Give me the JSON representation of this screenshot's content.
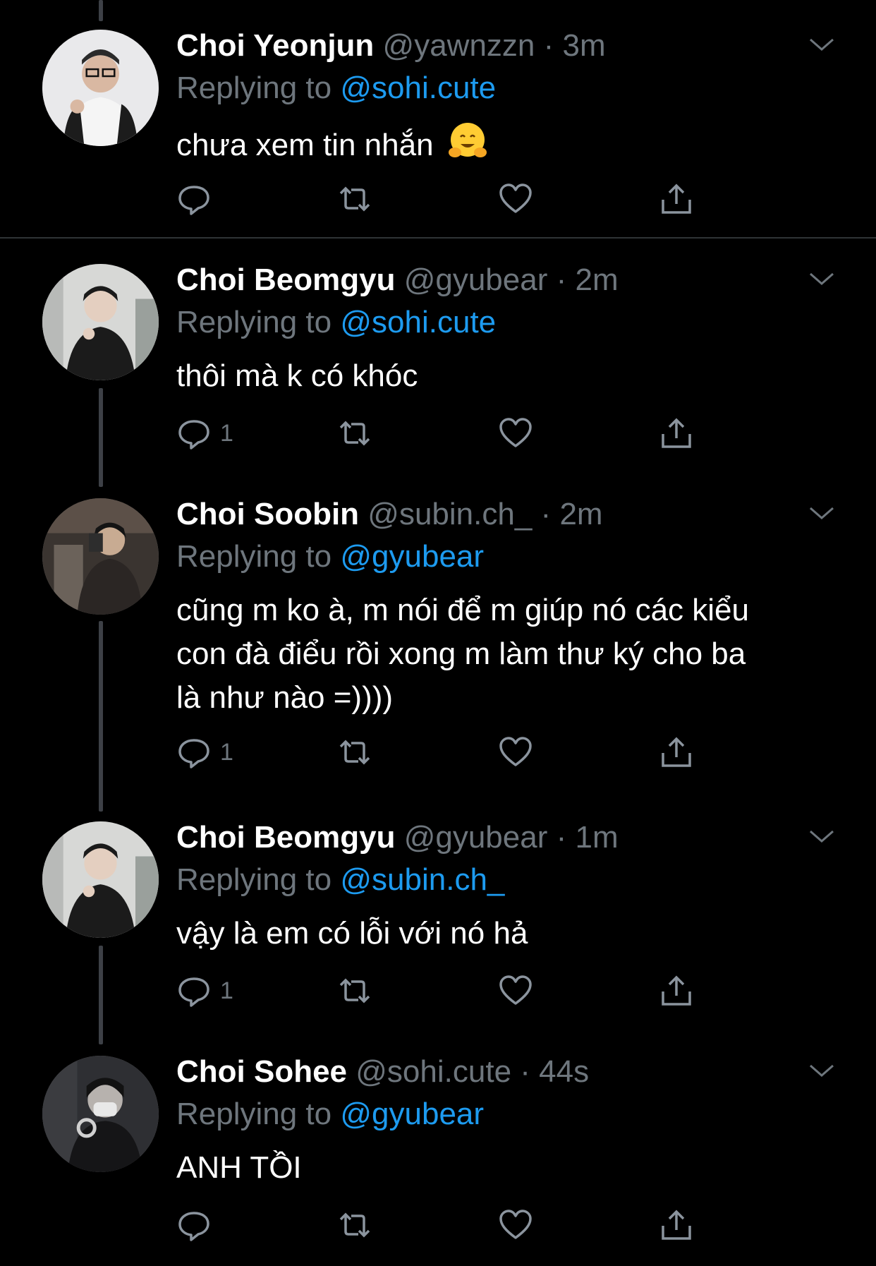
{
  "tweets": [
    {
      "name": "Choi Yeonjun",
      "handle": "@yawnzzn",
      "time": "3m",
      "replying_prefix": "Replying to ",
      "replying_to": "@sohi.cute",
      "text": "chưa xem tin nhắn",
      "emoji": "hugging-face",
      "reply_count": "",
      "avatar": "avatar-yeonjun"
    },
    {
      "name": "Choi Beomgyu",
      "handle": "@gyubear",
      "time": "2m",
      "replying_prefix": "Replying to ",
      "replying_to": "@sohi.cute",
      "text": "thôi mà k có khóc",
      "reply_count": "1",
      "avatar": "avatar-beomgyu"
    },
    {
      "name": "Choi Soobin",
      "handle": "@subin.ch_",
      "time": "2m",
      "replying_prefix": "Replying to ",
      "replying_to": "@gyubear",
      "text_lines": [
        "cũng m ko à, m nói để m giúp nó các kiểu",
        "con đà điểu rồi xong m làm thư ký cho ba",
        "là như nào =))))"
      ],
      "reply_count": "1",
      "avatar": "avatar-soobin"
    },
    {
      "name": "Choi Beomgyu",
      "handle": "@gyubear",
      "time": "1m",
      "replying_prefix": "Replying to ",
      "replying_to": "@subin.ch_",
      "text": "vậy là em có lỗi với nó hả",
      "reply_count": "1",
      "avatar": "avatar-beomgyu"
    },
    {
      "name": "Choi Sohee",
      "handle": "@sohi.cute",
      "time": "44s",
      "replying_prefix": "Replying to ",
      "replying_to": "@gyubear",
      "text": "ANH TỒI",
      "reply_count": "",
      "avatar": "avatar-sohee"
    }
  ],
  "separator": " · ",
  "colors": {
    "background": "#000000",
    "muted": "#6e767d",
    "link": "#1d9bf0",
    "thread": "#3d4046"
  },
  "icons": [
    "reply-icon",
    "retweet-icon",
    "like-icon",
    "share-icon",
    "chevron-down-icon"
  ]
}
